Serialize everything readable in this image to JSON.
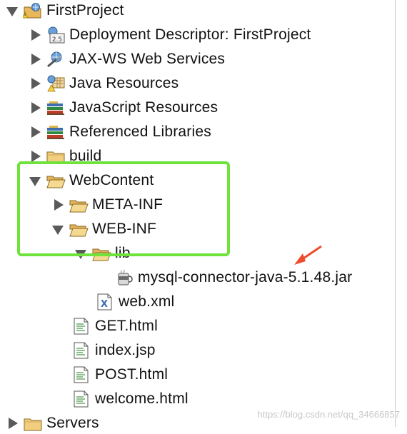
{
  "tree": {
    "items": [
      {
        "label": "FirstProject",
        "icon": "project-icon",
        "toggle": "down"
      },
      {
        "label": "Deployment Descriptor: FirstProject",
        "icon": "deployment-descriptor-icon",
        "toggle": "right"
      },
      {
        "label": "JAX-WS Web Services",
        "icon": "web-services-icon",
        "toggle": "right"
      },
      {
        "label": "Java Resources",
        "icon": "java-resources-icon",
        "toggle": "right"
      },
      {
        "label": "JavaScript Resources",
        "icon": "library-icon",
        "toggle": "right"
      },
      {
        "label": "Referenced Libraries",
        "icon": "library-icon",
        "toggle": "right"
      },
      {
        "label": "build",
        "icon": "folder-icon",
        "toggle": "right"
      },
      {
        "label": "WebContent",
        "icon": "folder-open-icon",
        "toggle": "down"
      },
      {
        "label": "META-INF",
        "icon": "folder-icon",
        "toggle": "right"
      },
      {
        "label": "WEB-INF",
        "icon": "folder-open-icon",
        "toggle": "down"
      },
      {
        "label": "lib",
        "icon": "folder-open-icon",
        "toggle": "down"
      },
      {
        "label": "mysql-connector-java-5.1.48.jar",
        "icon": "jar-icon",
        "toggle": "none"
      },
      {
        "label": "web.xml",
        "icon": "xml-file-icon",
        "toggle": "none"
      },
      {
        "label": "GET.html",
        "icon": "html-file-icon",
        "toggle": "none"
      },
      {
        "label": "index.jsp",
        "icon": "jsp-file-icon",
        "toggle": "none"
      },
      {
        "label": "POST.html",
        "icon": "html-file-icon",
        "toggle": "none"
      },
      {
        "label": "welcome.html",
        "icon": "html-file-icon",
        "toggle": "none"
      },
      {
        "label": "Servers",
        "icon": "folder-icon",
        "toggle": "right"
      }
    ]
  },
  "annotations": {
    "highlight_color": "#6fe23b",
    "arrow_color": "#ee4b2b"
  },
  "watermark": "https://blog.csdn.net/qq_34666857"
}
